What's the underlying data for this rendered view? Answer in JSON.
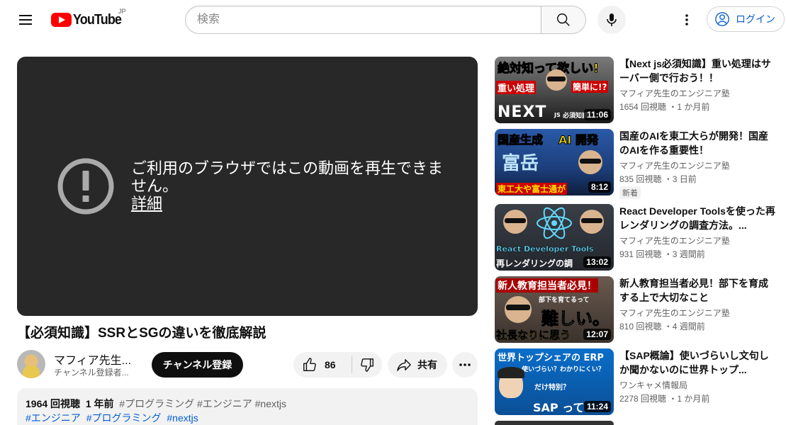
{
  "header": {
    "logo_text": "YouTube",
    "logo_country": "JP",
    "search_placeholder": "検索",
    "signin_label": "ログイン",
    "icons": [
      "menu-icon",
      "search-icon",
      "mic-icon",
      "more-vert-icon",
      "account-icon"
    ]
  },
  "player": {
    "error_message": "ご利用のブラウザではこの動画を再生できません。",
    "error_link": "詳細"
  },
  "video": {
    "title": "【必須知識】SSRとSGの違いを徹底解説",
    "channel_name": "マフィア先生のエンジニア塾",
    "channel_name_display": "マフィア先生...",
    "channel_subs": "チャンネル登録者...",
    "subscribe_label": "チャンネル登録",
    "like_count": "86",
    "share_label": "共有",
    "views": "1964 回視聴",
    "date": "1 年前",
    "inline_tags": "#プログラミング #エンジニア #nextjs",
    "tags": [
      "#エンジニア",
      "#プログラミング",
      "#nextjs"
    ]
  },
  "recommendations": [
    {
      "title": "【Next js必須知識】重い処理はサーバー側で行おう！！",
      "channel": "マフィア先生のエンジニア塾",
      "meta": "1654 回視聴 ・1 か月前",
      "duration": "11:06",
      "thumb_text": [
        "絶対知って欲しい!",
        "重い処理",
        "簡単に!?",
        "NEXT",
        "JS",
        "必須知識"
      ],
      "badge": ""
    },
    {
      "title": "国産のAIを東工大らが開発！国産のAIを作る重要性！",
      "channel": "マフィア先生のエンジニア塾",
      "meta": "835 回視聴 ・3 日前",
      "duration": "8:12",
      "thumb_text": [
        "国産生成",
        "AI 開発",
        "富岳",
        "東工大や富士通が"
      ],
      "badge": "新着"
    },
    {
      "title": "React Developer Toolsを使った再レンダリングの調査方法。...",
      "channel": "マフィア先生のエンジニア塾",
      "meta": "931 回視聴 ・3 週間前",
      "duration": "13:02",
      "thumb_text": [
        "React Developer Tools",
        "再レンダリングの調"
      ],
      "badge": ""
    },
    {
      "title": "新人教育担当者必見！部下を育成する上で大切なこと",
      "channel": "マフィア先生のエンジニア塾",
      "meta": "810 回視聴 ・4 週間前",
      "duration": "12:07",
      "thumb_text": [
        "新人教育担当者必見！",
        "部下を育てるって",
        "難しい。",
        "社長なりに思う"
      ],
      "badge": ""
    },
    {
      "title": "【SAP概論】使いづらいし文句しか聞かないのに世界トップ...",
      "channel": "ワンキャメ情報局",
      "meta": "2278 回視聴 ・1 か月前",
      "duration": "11:24",
      "thumb_text": [
        "世界トップシェアの ERP",
        "使いづらい？わかりにくい？",
        "だけ特別？",
        "SAP って"
      ],
      "badge": ""
    }
  ],
  "colors": {
    "brand_red": "#ff0000",
    "link_blue": "#065fd4",
    "player_bg": "#282828"
  }
}
